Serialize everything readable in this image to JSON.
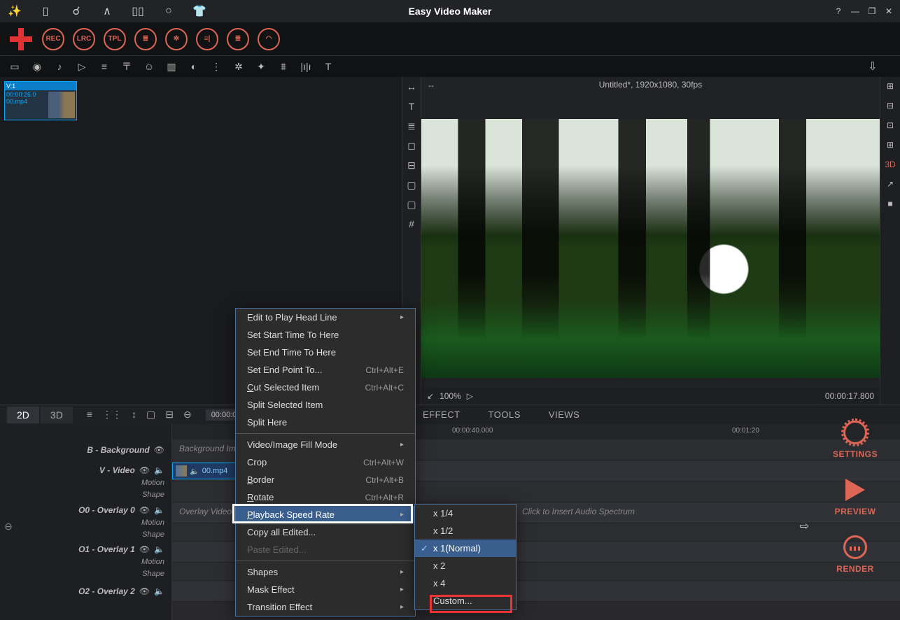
{
  "app": {
    "title": "Easy Video Maker"
  },
  "window_controls": {
    "help": "?",
    "min": "—",
    "restore": "❐",
    "close": "✕"
  },
  "main_toolbar": {
    "circles": [
      "REC",
      "LRC",
      "TPL",
      "≣",
      "✲",
      "≡|",
      "≣",
      "◠"
    ]
  },
  "sub_toolbar": [
    "▭",
    "◉",
    "♪",
    "▷",
    "≡",
    "〒",
    "☺",
    "▥",
    "◐",
    "⋮",
    "✲",
    "✦",
    "⩩",
    "|ı|ı",
    "T"
  ],
  "media_bin": {
    "clip": {
      "header": "V:1",
      "duration": "00:00:26.0",
      "filename": "00.mp4"
    }
  },
  "mid_tools": [
    "↔",
    "T",
    "≣",
    "◻",
    "⊟",
    "▢",
    "▢",
    "#"
  ],
  "preview": {
    "info": "Untitled*, 1920x1080, 30fps",
    "zoom": "100%",
    "time": "00:00:17.800"
  },
  "right_tools": [
    "⊞",
    "⊟",
    "⊡",
    "⊞",
    "3D",
    "↗",
    "■"
  ],
  "timeline": {
    "tabs": {
      "d2": "2D",
      "d3": "3D"
    },
    "time0": "00:00:00.000",
    "ruler": [
      "00:00:40.000",
      "00:01:20"
    ],
    "right_tabs": [
      "EFFECT",
      "TOOLS",
      "VIEWS"
    ],
    "tracks": {
      "bg": {
        "name": "B - Background",
        "ph": "Background Im"
      },
      "vid": {
        "name": "V - Video",
        "s1": "Motion",
        "s2": "Shape",
        "clip": "00.mp4"
      },
      "o0": {
        "name": "O0 - Overlay 0",
        "s1": "Motion",
        "s2": "Shape",
        "ph": "Overlay Video"
      },
      "o1": {
        "name": "O1 - Overlay 1",
        "s1": "Motion",
        "s2": "Shape"
      },
      "o2": {
        "name": "O2 - Overlay 2"
      },
      "spectrum": "Click to Insert Audio Spectrum"
    }
  },
  "right_actions": {
    "settings": "SETTINGS",
    "preview": "PREVIEW",
    "render": "RENDER"
  },
  "context_menu": {
    "items": [
      {
        "label": "Edit to Play Head Line",
        "sub": true
      },
      {
        "label": "Set Start Time To Here"
      },
      {
        "label": "Set End Time To Here"
      },
      {
        "label": "Set End Point To...",
        "shortcut": "Ctrl+Alt+E"
      },
      {
        "label_html": "<u>C</u>ut Selected Item",
        "shortcut": "Ctrl+Alt+C"
      },
      {
        "label": "Split Selected Item"
      },
      {
        "label": "Split Here"
      },
      {
        "sep": true
      },
      {
        "label": "Video/Image Fill Mode",
        "sub": true
      },
      {
        "label": "Crop",
        "shortcut": "Ctrl+Alt+W"
      },
      {
        "label_html": "<u>B</u>order",
        "shortcut": "Ctrl+Alt+B"
      },
      {
        "label_html": "<u>R</u>otate",
        "shortcut": "Ctrl+Alt+R"
      },
      {
        "label_html": "<u>P</u>layback Speed Rate",
        "sub": true,
        "hi": true
      },
      {
        "label": "Copy all Edited..."
      },
      {
        "label": "Paste Edited...",
        "disabled": true
      },
      {
        "sep": true
      },
      {
        "label": "Shapes",
        "sub": true
      },
      {
        "label": "Mask Effect",
        "sub": true
      },
      {
        "label": "Transition Effect",
        "sub": true
      }
    ],
    "speed_items": [
      {
        "label": "x 1/4"
      },
      {
        "label": "x 1/2"
      },
      {
        "label": "x 1(Normal)",
        "hi": true,
        "chk": true
      },
      {
        "label": "x 2"
      },
      {
        "label": "x 4"
      },
      {
        "label": "Custom..."
      }
    ]
  }
}
